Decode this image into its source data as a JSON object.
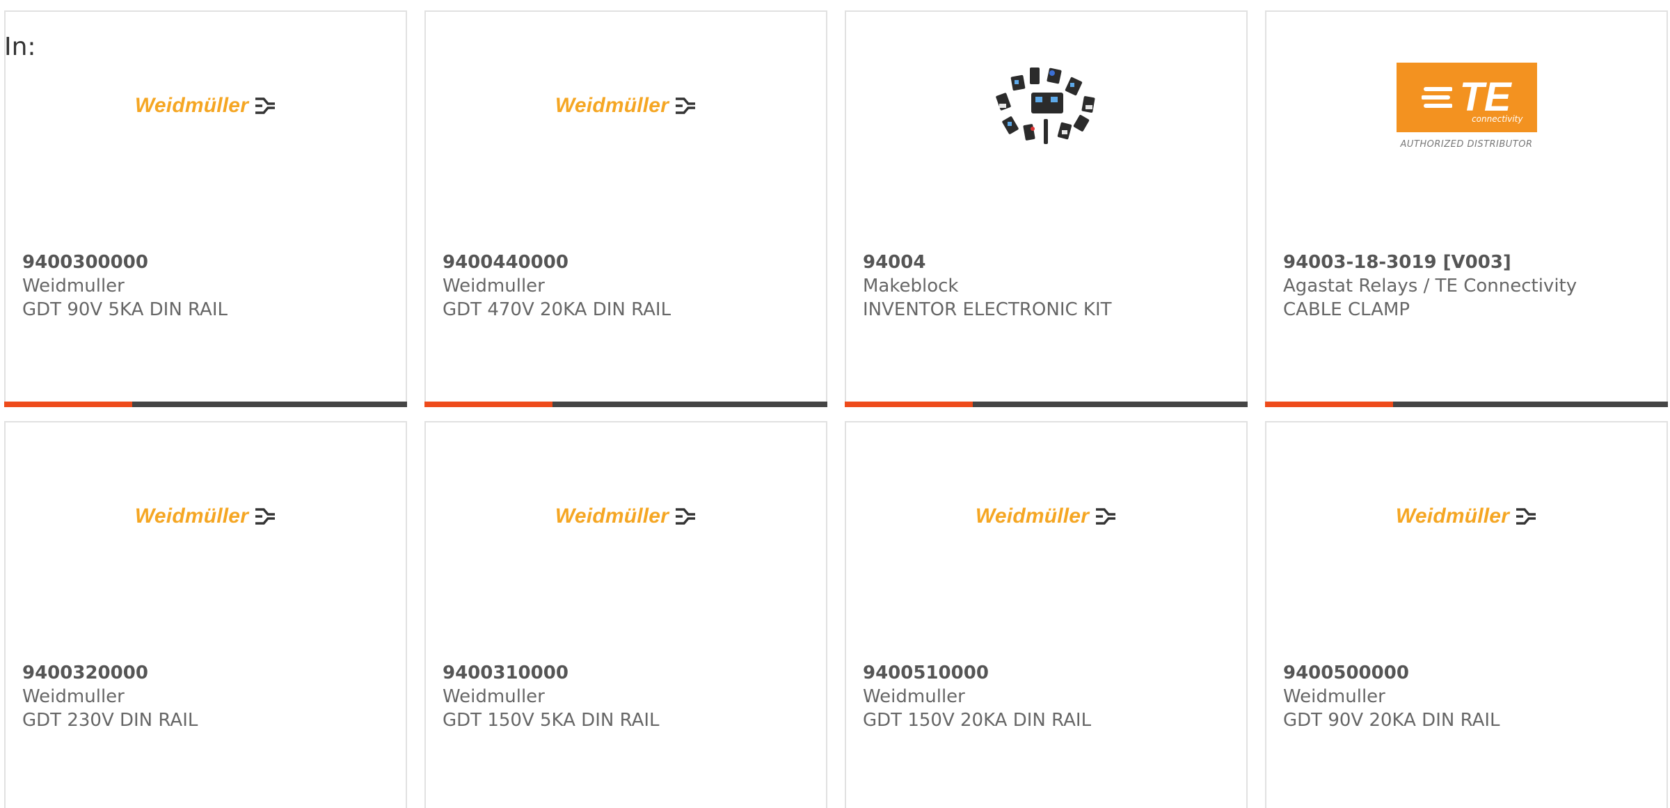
{
  "header": {
    "label": "In:"
  },
  "products": [
    {
      "part_number": "9400300000",
      "manufacturer": "Weidmuller",
      "description": "GDT 90V 5KA DIN RAIL",
      "logo": "weidmuller-logo",
      "logo_text": "Weidmüller"
    },
    {
      "part_number": "9400440000",
      "manufacturer": "Weidmuller",
      "description": "GDT 470V 20KA DIN RAIL",
      "logo": "weidmuller-logo",
      "logo_text": "Weidmüller"
    },
    {
      "part_number": "94004",
      "manufacturer": "Makeblock",
      "description": "INVENTOR ELECTRONIC KIT",
      "logo": "electronic-kit-photo"
    },
    {
      "part_number": "94003-18-3019 [V003]",
      "manufacturer": "Agastat Relays / TE Connectivity",
      "description": "CABLE CLAMP",
      "logo": "te-connectivity-logo",
      "logo_text": "TE",
      "logo_subtext": "connectivity",
      "logo_caption": "AUTHORIZED DISTRIBUTOR"
    },
    {
      "part_number": "9400320000",
      "manufacturer": "Weidmuller",
      "description": "GDT 230V DIN RAIL",
      "logo": "weidmuller-logo",
      "logo_text": "Weidmüller"
    },
    {
      "part_number": "9400310000",
      "manufacturer": "Weidmuller",
      "description": "GDT 150V 5KA DIN RAIL",
      "logo": "weidmuller-logo",
      "logo_text": "Weidmüller"
    },
    {
      "part_number": "9400510000",
      "manufacturer": "Weidmuller",
      "description": "GDT 150V 20KA DIN RAIL",
      "logo": "weidmuller-logo",
      "logo_text": "Weidmüller"
    },
    {
      "part_number": "9400500000",
      "manufacturer": "Weidmuller",
      "description": "GDT 90V 20KA DIN RAIL",
      "logo": "weidmuller-logo",
      "logo_text": "Weidmüller"
    }
  ],
  "colors": {
    "accent": "#ee4b1b",
    "bar": "#454545",
    "brand_weidmuller": "#f5a623",
    "brand_te": "#f39220"
  }
}
